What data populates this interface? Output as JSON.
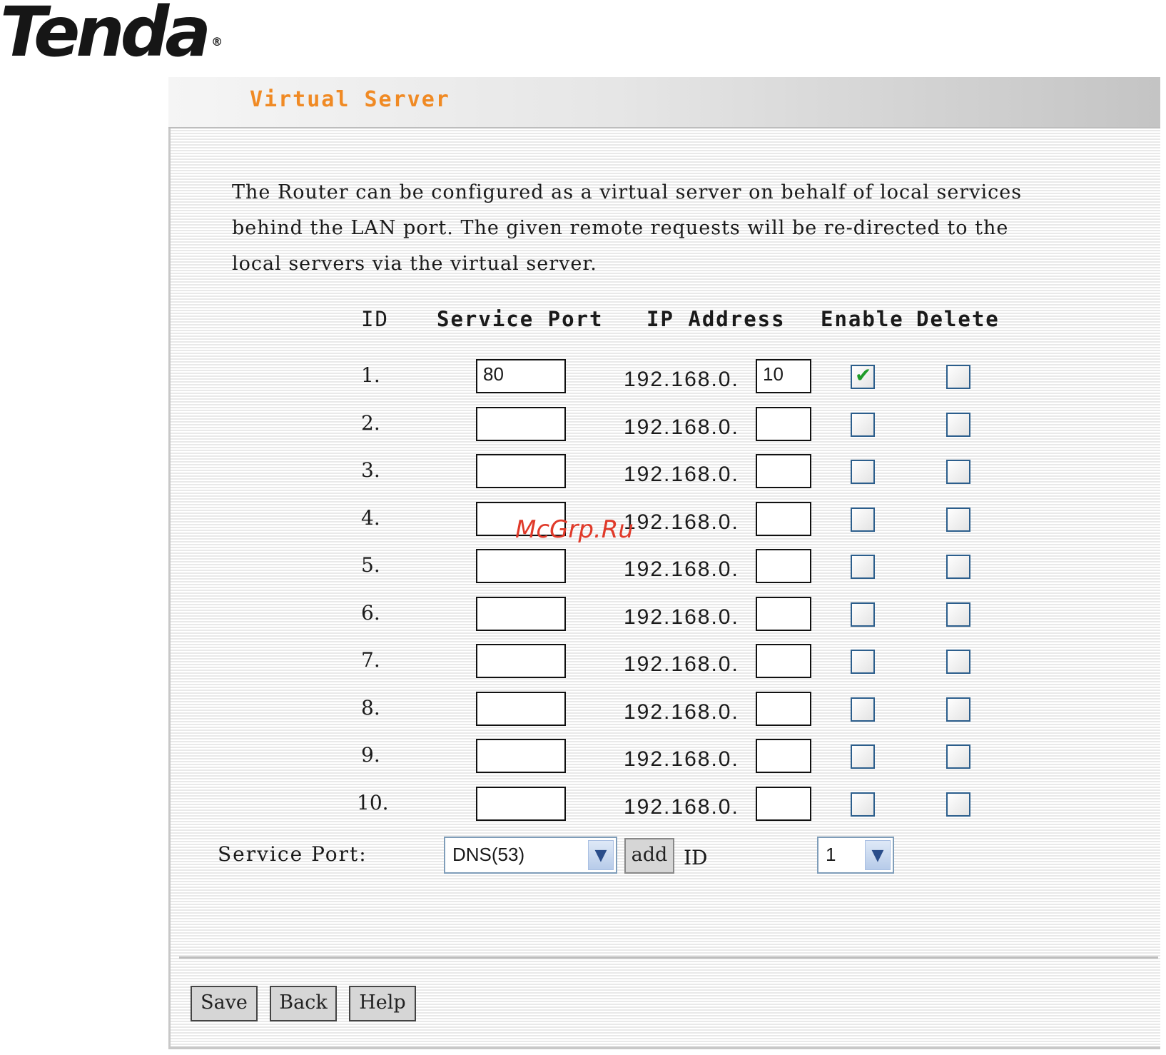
{
  "brand": {
    "logo_text": "Tenda",
    "registered_mark": "®"
  },
  "page": {
    "title": "Virtual Server",
    "intro": "The Router can be configured as a virtual server on behalf of local services behind the LAN port. The given remote requests will be re-directed to the local servers via the virtual server."
  },
  "table": {
    "headers": {
      "id": "ID",
      "service_port": "Service Port",
      "ip_address": "IP Address",
      "enable": "Enable",
      "delete": "Delete"
    },
    "ip_prefix": "192.168.0.",
    "rows": [
      {
        "id": "1.",
        "port": "80",
        "ip": "10",
        "enable": true,
        "delete": false
      },
      {
        "id": "2.",
        "port": "",
        "ip": "",
        "enable": false,
        "delete": false
      },
      {
        "id": "3.",
        "port": "",
        "ip": "",
        "enable": false,
        "delete": false
      },
      {
        "id": "4.",
        "port": "",
        "ip": "",
        "enable": false,
        "delete": false
      },
      {
        "id": "5.",
        "port": "",
        "ip": "",
        "enable": false,
        "delete": false
      },
      {
        "id": "6.",
        "port": "",
        "ip": "",
        "enable": false,
        "delete": false
      },
      {
        "id": "7.",
        "port": "",
        "ip": "",
        "enable": false,
        "delete": false
      },
      {
        "id": "8.",
        "port": "",
        "ip": "",
        "enable": false,
        "delete": false
      },
      {
        "id": "9.",
        "port": "",
        "ip": "",
        "enable": false,
        "delete": false
      },
      {
        "id": "10.",
        "port": "",
        "ip": "",
        "enable": false,
        "delete": false
      }
    ]
  },
  "service_port": {
    "label": "Service Port:",
    "selected": "DNS(53)",
    "add_label": "add",
    "id_label": "ID",
    "id_selected": "1"
  },
  "buttons": {
    "save": "Save",
    "back": "Back",
    "help": "Help"
  },
  "watermark": "McGrp.Ru",
  "colors": {
    "title": "#f08a24",
    "check": "#1e9b28",
    "checkbox_border": "#2c5e8c"
  },
  "icons": {
    "dropdown": "chevron-down-icon",
    "check": "checkmark-icon"
  }
}
